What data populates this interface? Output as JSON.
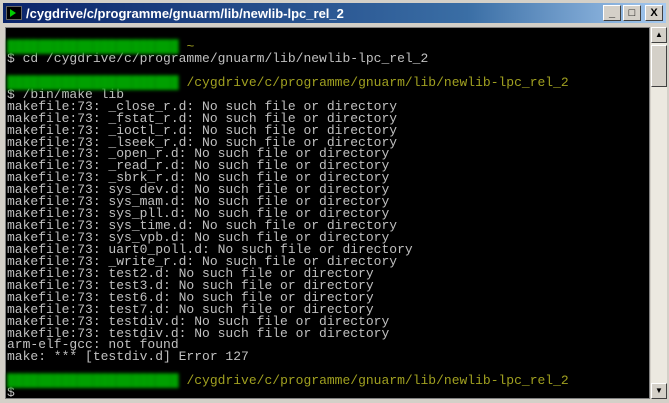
{
  "window": {
    "title": "/cygdrive/c/programme/gnuarm/lib/newlib-lpc_rel_2",
    "minimize": "_",
    "maximize": "□",
    "close": "X"
  },
  "terminal": {
    "prompt_user_redacted": "██████████████████████",
    "lines": [
      {
        "type": "prompt",
        "path": "~"
      },
      {
        "type": "text",
        "text": "$ cd /cygdrive/c/programme/gnuarm/lib/newlib-lpc_rel_2"
      },
      {
        "type": "text",
        "text": ""
      },
      {
        "type": "prompt",
        "path": "/cygdrive/c/programme/gnuarm/lib/newlib-lpc_rel_2"
      },
      {
        "type": "text",
        "text": "$ /bin/make lib"
      },
      {
        "type": "text",
        "text": "makefile:73: _close_r.d: No such file or directory"
      },
      {
        "type": "text",
        "text": "makefile:73: _fstat_r.d: No such file or directory"
      },
      {
        "type": "text",
        "text": "makefile:73: _ioctl_r.d: No such file or directory"
      },
      {
        "type": "text",
        "text": "makefile:73: _lseek_r.d: No such file or directory"
      },
      {
        "type": "text",
        "text": "makefile:73: _open_r.d: No such file or directory"
      },
      {
        "type": "text",
        "text": "makefile:73: _read_r.d: No such file or directory"
      },
      {
        "type": "text",
        "text": "makefile:73: _sbrk_r.d: No such file or directory"
      },
      {
        "type": "text",
        "text": "makefile:73: sys_dev.d: No such file or directory"
      },
      {
        "type": "text",
        "text": "makefile:73: sys_mam.d: No such file or directory"
      },
      {
        "type": "text",
        "text": "makefile:73: sys_pll.d: No such file or directory"
      },
      {
        "type": "text",
        "text": "makefile:73: sys_time.d: No such file or directory"
      },
      {
        "type": "text",
        "text": "makefile:73: sys_vpb.d: No such file or directory"
      },
      {
        "type": "text",
        "text": "makefile:73: uart0_poll.d: No such file or directory"
      },
      {
        "type": "text",
        "text": "makefile:73: _write_r.d: No such file or directory"
      },
      {
        "type": "text",
        "text": "makefile:73: test2.d: No such file or directory"
      },
      {
        "type": "text",
        "text": "makefile:73: test3.d: No such file or directory"
      },
      {
        "type": "text",
        "text": "makefile:73: test6.d: No such file or directory"
      },
      {
        "type": "text",
        "text": "makefile:73: test7.d: No such file or directory"
      },
      {
        "type": "text",
        "text": "makefile:73: testdiv.d: No such file or directory"
      },
      {
        "type": "text",
        "text": "makefile:73: testdiv.d: No such file or directory"
      },
      {
        "type": "text",
        "text": "arm-elf-gcc: not found"
      },
      {
        "type": "text",
        "text": "make: *** [testdiv.d] Error 127"
      },
      {
        "type": "text",
        "text": ""
      },
      {
        "type": "prompt",
        "path": "/cygdrive/c/programme/gnuarm/lib/newlib-lpc_rel_2"
      },
      {
        "type": "text",
        "text": "$"
      }
    ]
  },
  "scrollbar": {
    "up": "▲",
    "down": "▼"
  }
}
